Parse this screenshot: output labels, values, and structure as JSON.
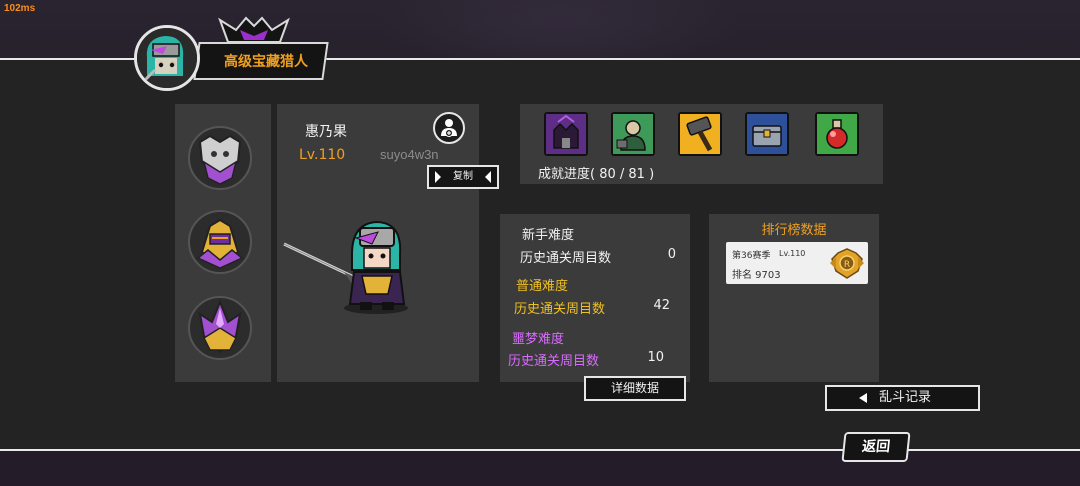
{
  "debug": {
    "fps_text": "102ms"
  },
  "header": {
    "title": "高级宝藏猎人",
    "icons": [
      "player-avatar-icon",
      "demon-crown-icon"
    ]
  },
  "medals": [
    "silver-skull-medal-icon",
    "gold-knight-helmet-medal-icon",
    "purple-crystal-medal-icon"
  ],
  "profile": {
    "name": "惠乃果",
    "level": "Lv.110",
    "id": "suyo4w3n",
    "copy_label": "复制",
    "add_friend_icon": "add-friend-icon"
  },
  "achievements": {
    "icons": [
      "dark-castle-icon",
      "green-shopkeeper-icon",
      "hammer-icon",
      "treasure-chest-icon",
      "red-potion-icon"
    ],
    "progress_label": "成就进度( 80 / 81 )"
  },
  "difficulty": {
    "novice": {
      "title": "新手难度",
      "label": "历史通关周目数",
      "value": "0"
    },
    "normal": {
      "title": "普通难度",
      "label": "历史通关周目数",
      "value": "42"
    },
    "nightmare": {
      "title": "噩梦难度",
      "label": "历史通关周目数",
      "value": "10"
    },
    "detail_button": "详细数据"
  },
  "leaderboard": {
    "title": "排行榜数据",
    "season": "第36赛季",
    "level": "Lv.110",
    "rank": "排名 9703",
    "badge_icon": "gold-rank-badge-icon"
  },
  "buttons": {
    "brawl_record": "乱斗记录",
    "back": "返回"
  },
  "colors": {
    "accent_orange": "#f0a020",
    "nightmare_purple": "#d86bff",
    "panel": "#3b3b3b",
    "band": "#232323"
  }
}
